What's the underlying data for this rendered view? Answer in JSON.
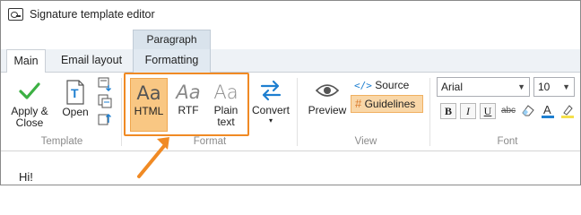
{
  "window": {
    "title": "Signature template editor"
  },
  "context_group": {
    "label": "Paragraph"
  },
  "tabs": [
    {
      "label": "Main",
      "active": true
    },
    {
      "label": "Email layout"
    },
    {
      "label": "Formatting"
    }
  ],
  "ribbon": {
    "template_group": {
      "label": "Template",
      "apply_close": [
        "Apply &",
        "Close"
      ],
      "open": "Open"
    },
    "format_group": {
      "label": "Format",
      "html": {
        "glyph": "Aa",
        "label": "HTML",
        "selected": true
      },
      "rtf": {
        "glyph": "Aa",
        "label": "RTF"
      },
      "plain": {
        "glyph": "Aa",
        "label": [
          "Plain",
          "text"
        ]
      },
      "convert": {
        "label": "Convert"
      }
    },
    "view_group": {
      "label": "View",
      "preview": "Preview",
      "source": "Source",
      "source_prefix": "</>",
      "guidelines": "Guidelines",
      "guidelines_on": true
    },
    "font_group": {
      "label": "Font",
      "font_family": "Arial",
      "font_size": "10",
      "bold": "B",
      "italic": "I",
      "underline": "U",
      "strike": "abc"
    }
  },
  "editor": {
    "content": "Hi!"
  },
  "colors": {
    "accent": "#f08a24",
    "selected_fill": "#f9c783",
    "check": "#3cb043",
    "blue_icon": "#1e7fd0"
  }
}
